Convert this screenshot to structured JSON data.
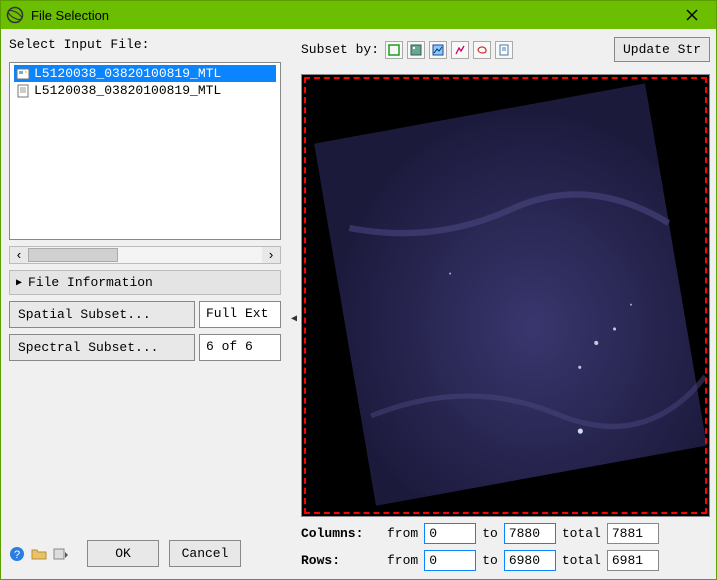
{
  "window": {
    "title": "File Selection"
  },
  "left": {
    "select_label": "Select Input File:",
    "files": [
      {
        "name": "L5120038_03820100819_MTL",
        "selected": true
      },
      {
        "name": "L5120038_03820100819_MTL",
        "selected": false
      }
    ],
    "file_info_header": "File Information",
    "spatial_btn": "Spatial Subset...",
    "spatial_value": "Full Ext",
    "spectral_btn": "Spectral Subset...",
    "spectral_value": "6 of 6 ",
    "ok": "OK",
    "cancel": "Cancel"
  },
  "right": {
    "subset_label": "Subset by:",
    "update_btn": "Update Str",
    "columns_label": "Columns:",
    "rows_label": "Rows:",
    "from_label": "from",
    "to_label": "to",
    "total_label": "total",
    "columns": {
      "from": "0",
      "to": "7880",
      "total": "7881"
    },
    "rows": {
      "from": "0",
      "to": "6980",
      "total": "6981"
    }
  },
  "icons": {
    "help": "help-icon",
    "folder": "folder-icon",
    "settings": "settings-icon"
  }
}
